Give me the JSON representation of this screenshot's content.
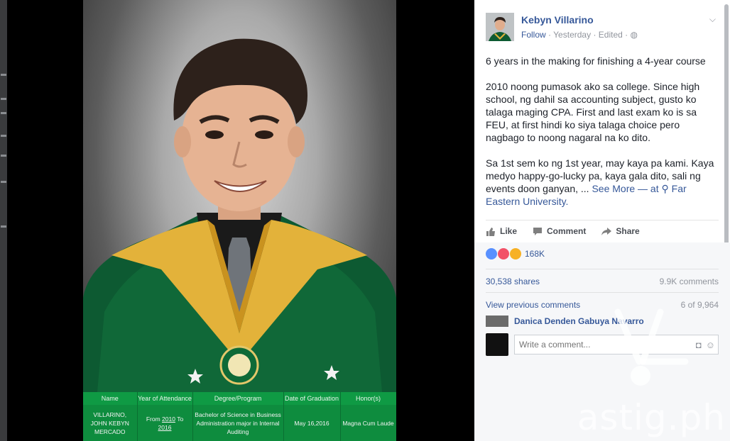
{
  "post": {
    "author": "Kebyn Villarino",
    "follow_label": "Follow",
    "time": "Yesterday",
    "edited": "Edited",
    "separator": "·",
    "paragraph1": "6 years in the making for finishing a 4-year course",
    "paragraph2": "2010 noong pumasok ako sa college. Since high school, ng dahil sa accounting subject, gusto ko talaga maging CPA. First and last exam ko is sa FEU, at first hindi ko siya talaga choice pero nagbago to noong nagaral na ko dito.",
    "paragraph3": "Sa 1st sem ko ng 1st year, may kaya pa kami. Kaya medyo happy-go-lucky pa, kaya gala dito, sali ng events doon ganyan, ...",
    "see_more": "See More",
    "at_prefix": "— at",
    "location": "Far Eastern University."
  },
  "actions": {
    "like": "Like",
    "comment": "Comment",
    "share": "Share"
  },
  "reactions": {
    "count": "168K",
    "colors": [
      "#5890ff",
      "#f25268",
      "#f7b125"
    ]
  },
  "stats": {
    "shares": "30,538 shares",
    "comments": "9.9K comments"
  },
  "comments": {
    "view_previous": "View previous comments",
    "page_count": "6 of 9,964",
    "commenter": "Danica Denden Gabuya Navarro",
    "input_placeholder": "Write a comment..."
  },
  "photo_table": {
    "headers": [
      "Name",
      "Year of Attendance",
      "Degree/Program",
      "Date of Graduation",
      "Honor(s)"
    ],
    "name": "VILLARINO, JOHN KEBYN MERCADO",
    "year_from": "From",
    "year_start": "2010",
    "year_to": "To",
    "year_end": "2016",
    "degree": "Bachelor of Science in Business Administration major in Internal Auditing",
    "graduation_date": "May 16,2016",
    "honor": "Magna Cum Laude"
  },
  "watermark": "astig.ph"
}
